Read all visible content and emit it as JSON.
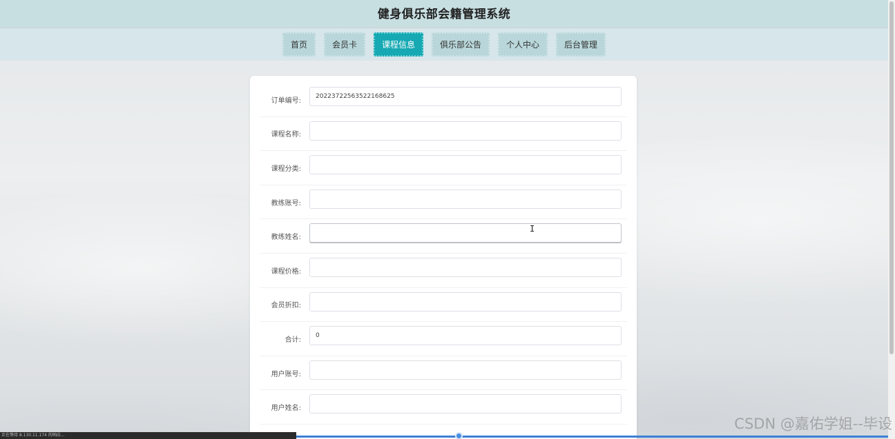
{
  "app": {
    "title": "健身俱乐部会籍管理系统"
  },
  "nav": {
    "items": [
      {
        "label": "首页",
        "active": false
      },
      {
        "label": "会员卡",
        "active": false
      },
      {
        "label": "课程信息",
        "active": true
      },
      {
        "label": "俱乐部公告",
        "active": false
      },
      {
        "label": "个人中心",
        "active": false
      },
      {
        "label": "后台管理",
        "active": false
      }
    ]
  },
  "form": {
    "fields": [
      {
        "label": "订单编号:",
        "value": "20223722563522168625"
      },
      {
        "label": "课程名称:",
        "value": ""
      },
      {
        "label": "课程分类:",
        "value": ""
      },
      {
        "label": "教练账号:",
        "value": ""
      },
      {
        "label": "教练姓名:",
        "value": ""
      },
      {
        "label": "课程价格:",
        "value": ""
      },
      {
        "label": "会员折扣:",
        "value": ""
      },
      {
        "label": "合计:",
        "value": "0"
      },
      {
        "label": "用户账号:",
        "value": ""
      },
      {
        "label": "用户姓名:",
        "value": ""
      }
    ]
  },
  "overlay": {
    "status_text": "正在等待 8.130.11.174 的响应...",
    "watermark": "CSDN @嘉佑学姐--毕设"
  },
  "colors": {
    "title_bar": "#c8dfe2",
    "nav_bar": "#d7e6ea",
    "nav_item": "#b9d7da",
    "nav_active": "#16a9b3"
  },
  "icons": {
    "cursor": "text-cursor-icon"
  }
}
